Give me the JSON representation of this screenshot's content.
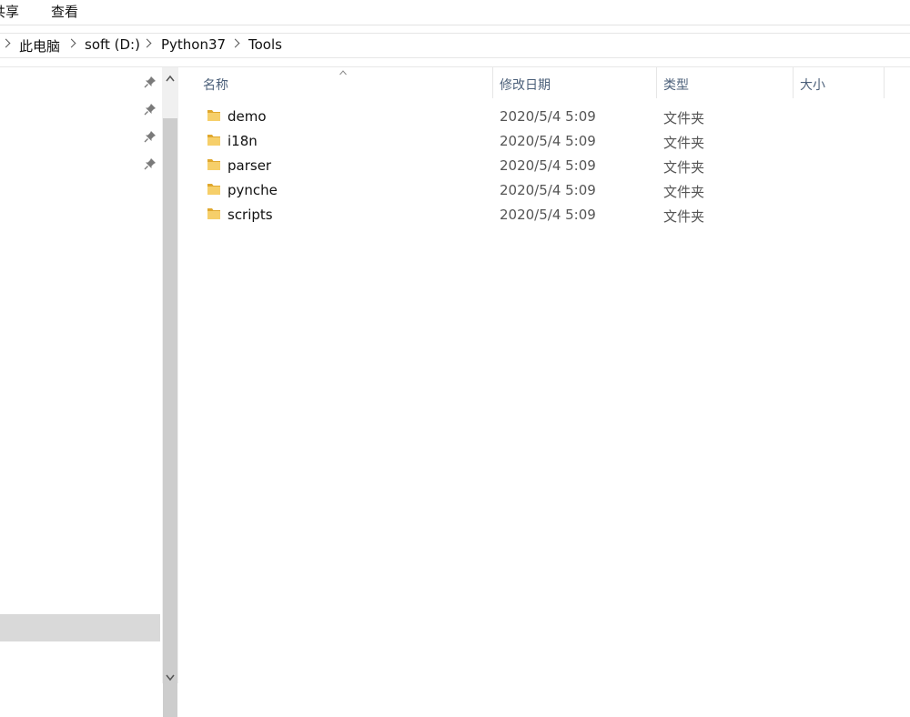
{
  "ribbon": {
    "tabs": [
      "共享",
      "查看"
    ]
  },
  "address": {
    "crumbs": [
      "此电脑",
      "soft (D:)",
      "Python37",
      "Tools"
    ]
  },
  "columns": {
    "name": "名称",
    "modified": "修改日期",
    "type": "类型",
    "size": "大小"
  },
  "files": [
    {
      "name": "demo",
      "modified": "2020/5/4 5:09",
      "type": "文件夹",
      "size": ""
    },
    {
      "name": "i18n",
      "modified": "2020/5/4 5:09",
      "type": "文件夹",
      "size": ""
    },
    {
      "name": "parser",
      "modified": "2020/5/4 5:09",
      "type": "文件夹",
      "size": ""
    },
    {
      "name": "pynche",
      "modified": "2020/5/4 5:09",
      "type": "文件夹",
      "size": ""
    },
    {
      "name": "scripts",
      "modified": "2020/5/4 5:09",
      "type": "文件夹",
      "size": ""
    }
  ],
  "icons": {
    "folder": "folder-icon",
    "pin": "pin-icon",
    "sort": "sort-ascending-icon",
    "chevron": "chevron-right-icon"
  },
  "colors": {
    "folder": "#f2c55c",
    "folder_dark": "#e0a82e",
    "header_text": "#4c607a",
    "selection": "#d9d9d9"
  }
}
